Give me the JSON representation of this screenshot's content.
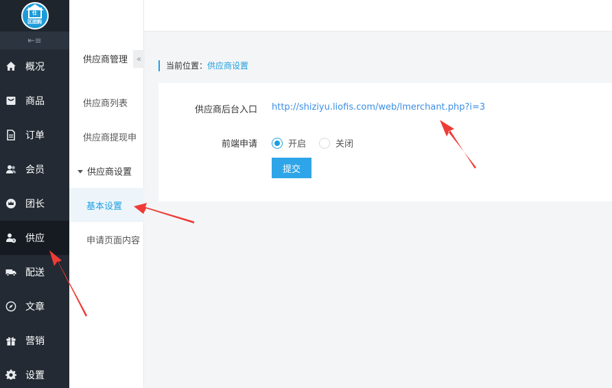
{
  "brand": {
    "logo_top": "仕",
    "logo_text": "区团购"
  },
  "nav": {
    "items": [
      {
        "label": "概况",
        "icon": "home-icon"
      },
      {
        "label": "商品",
        "icon": "goods-icon"
      },
      {
        "label": "订单",
        "icon": "order-icon"
      },
      {
        "label": "会员",
        "icon": "members-icon"
      },
      {
        "label": "团长",
        "icon": "leader-icon"
      },
      {
        "label": "供应",
        "icon": "supplier-icon",
        "active": true
      },
      {
        "label": "配送",
        "icon": "truck-icon"
      },
      {
        "label": "文章",
        "icon": "compass-icon"
      },
      {
        "label": "营销",
        "icon": "gift-icon"
      },
      {
        "label": "设置",
        "icon": "gear-icon"
      }
    ]
  },
  "submenu": {
    "title": "供应商管理",
    "collapse": "«",
    "items": [
      "供应商列表",
      "供应商提现申"
    ],
    "group": "供应商设置",
    "active": "基本设置",
    "item_after": "申请页面内容"
  },
  "breadcrumb": {
    "prefix": "当前位置：",
    "current": "供应商设置"
  },
  "form": {
    "entry_label": "供应商后台入口",
    "entry_url": "http://shiziyu.liofis.com/web/lmerchant.php?i=3",
    "apply_label": "前端申请",
    "options": [
      {
        "label": "开启",
        "selected": true
      },
      {
        "label": "关闭",
        "selected": false
      }
    ],
    "submit_label": "提交"
  },
  "colors": {
    "accent": "#1e9fe0",
    "nav_bg": "#232a33",
    "annotation": "#ef3b36"
  }
}
